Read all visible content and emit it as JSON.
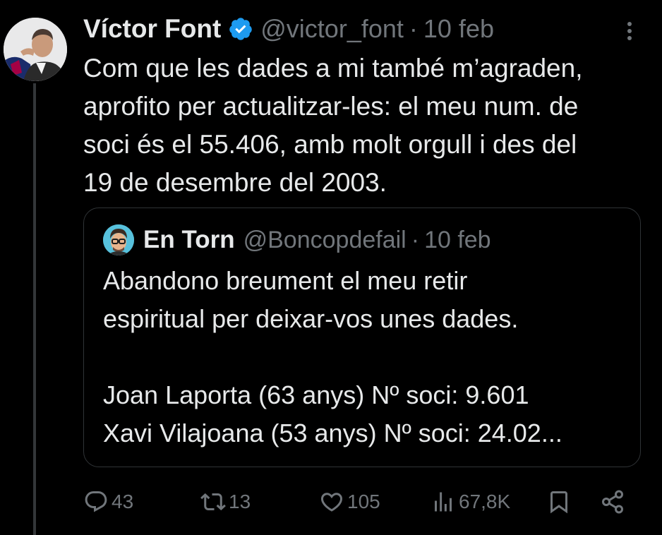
{
  "colors": {
    "background": "#000000",
    "text_primary": "#e7e9ea",
    "text_secondary": "#71767b",
    "verified": "#1d9bf0",
    "border": "#2f3336"
  },
  "tweet": {
    "author": {
      "name": "Víctor Font",
      "handle": "@victor_font",
      "verified_icon": "verified-badge-icon",
      "avatar": "avatar-photo"
    },
    "separator": "·",
    "date": "10 feb",
    "more_icon": "more-vertical-icon",
    "text_lines": [
      "Com que les dades a mi també m’agraden,",
      "aprofito per actualitzar-les: el meu num. de",
      "soci és el 55.406, amb molt orgull i des del",
      "19 de desembre del 2003."
    ]
  },
  "quoted_tweet": {
    "author": {
      "name": "En Torn",
      "handle": "@Boncopdefail",
      "avatar": "avatar-photo"
    },
    "separator": "·",
    "date": "10 feb",
    "text_lines": [
      "Abandono breument el meu retir",
      "espiritual per deixar-vos unes dades.",
      "",
      "Joan Laporta (63 anys) Nº soci: 9.601",
      "Xavi Vilajoana (53 anys) Nº soci: 24.02..."
    ]
  },
  "actions": {
    "reply": {
      "icon": "reply-icon",
      "count": "43"
    },
    "retweet": {
      "icon": "retweet-icon",
      "count": "13"
    },
    "like": {
      "icon": "heart-icon",
      "count": "105"
    },
    "views": {
      "icon": "views-icon",
      "count": "67,8K"
    },
    "bookmark": {
      "icon": "bookmark-icon"
    },
    "share": {
      "icon": "share-icon"
    }
  }
}
